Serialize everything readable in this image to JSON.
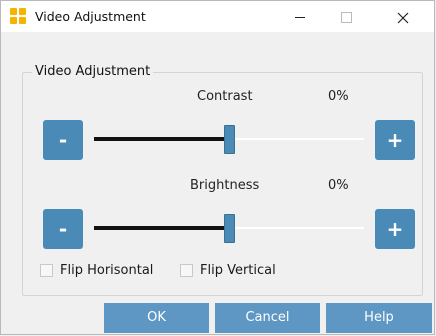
{
  "window": {
    "title": "Video Adjustment",
    "controls": {
      "minimize": "minimize",
      "maximize": "maximize",
      "close": "close"
    }
  },
  "group": {
    "label": "Video Adjustment"
  },
  "contrast": {
    "label": "Contrast",
    "value_text": "0%",
    "decrease_label": "-",
    "increase_label": "+",
    "slider_value": 0.5
  },
  "brightness": {
    "label": "Brightness",
    "value_text": "0%",
    "decrease_label": "-",
    "increase_label": "+",
    "slider_value": 0.5
  },
  "options": {
    "flip_horizontal": {
      "label": "Flip Horisontal",
      "checked": false
    },
    "flip_vertical": {
      "label": "Flip Vertical",
      "checked": false
    }
  },
  "buttons": {
    "ok": "OK",
    "cancel": "Cancel",
    "help": "Help"
  },
  "colors": {
    "accent": "#4a8ab7",
    "button": "#5e97c3",
    "app_icon": "#f6b400"
  }
}
